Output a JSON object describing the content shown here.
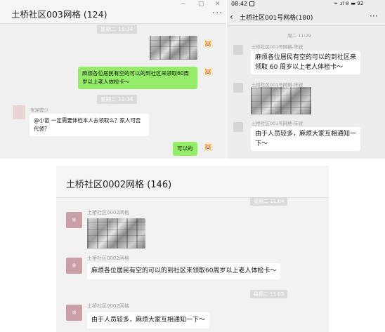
{
  "panel1": {
    "title": "土桥社区003网格 (124)",
    "window_controls": [
      "─",
      "□",
      "✕"
    ],
    "more": "···",
    "time1": "星期二 11:34",
    "msg_green1": "麻烦各位居民有空的可以的到社区来领取60周岁以上老人体检卡～",
    "time2": "星期二 11:34",
    "sender": "张湘蓉少",
    "msg_white1": "@小苗 一定需要体检本人去领取么？家人可否代领？",
    "msg_green2": "可以的"
  },
  "panel2": {
    "status_time": "08:42",
    "status_icons": "≈ .ıl ⊘ ▬ 92",
    "title": "土桥社区001号网格(180)",
    "more": "···",
    "time": "周二 11:29",
    "sender": "土桥社区001号网格-朱锐",
    "msg1": "麻烦各位居民有空的可以的到社区来领取 60 周岁以上老人体检卡～",
    "msg2": "由于人员较多，麻烦大家互相通知一下～"
  },
  "panel3": {
    "title": "土桥社区0002网格 (146)",
    "time1": "星期二 11:04",
    "sender": "土桥社区0002网格",
    "msg1": "麻烦各位居民有空的可以的到社区来领取60周岁以上老人体检卡～",
    "time2": "星期二 11:05",
    "msg2": "由于人员较多，麻烦大家互相通知一下～"
  }
}
